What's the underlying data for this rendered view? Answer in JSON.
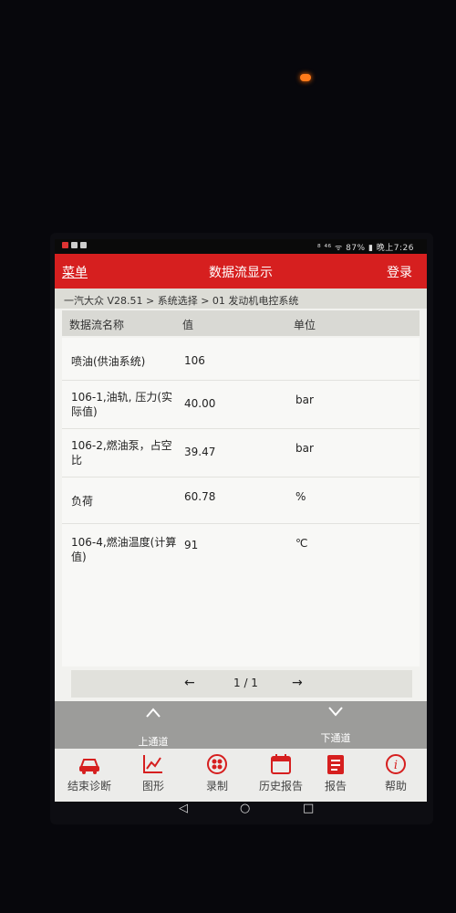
{
  "statusbar": {
    "right": "⁸ ⁴⁶ ᯤ 87% ▮ 晚上7:26"
  },
  "header": {
    "menu": "菜单",
    "title": "数据流显示",
    "login": "登录"
  },
  "breadcrumb": "一汽大众 V28.51 > 系统选择 > 01 发动机电控系统",
  "table": {
    "headers": [
      "数据流名称",
      "值",
      "单位"
    ],
    "rows": [
      {
        "name": "喷油(供油系统)",
        "value": "106",
        "unit": ""
      },
      {
        "name": "106-1,油轨, 压力(实际值)",
        "value": "40.00",
        "unit": "bar"
      },
      {
        "name": "106-2,燃油泵，占空比",
        "value": "39.47",
        "unit": "bar"
      },
      {
        "name": "负荷",
        "value": "60.78",
        "unit": "%"
      },
      {
        "name": "106-4,燃油温度(计算值)",
        "value": "91",
        "unit": "℃"
      }
    ]
  },
  "pager": {
    "prev": "←",
    "page": "1 / 1",
    "next": "→"
  },
  "channel": {
    "up_icon": "chevron-up-icon",
    "up": "上通道",
    "down_icon": "chevron-down-icon",
    "down": "下通道"
  },
  "bottom_nav": [
    {
      "label": "结束诊断",
      "icon": "car-icon"
    },
    {
      "label": "图形",
      "icon": "chart-icon"
    },
    {
      "label": "录制",
      "icon": "record-icon"
    },
    {
      "label": "历史报告",
      "icon": "calendar-icon"
    },
    {
      "label": "报告",
      "icon": "report-icon"
    },
    {
      "label": "帮助",
      "icon": "info-icon"
    }
  ],
  "colors": {
    "accent": "#d61f1f",
    "channel_bar": "#9c9c9a"
  }
}
